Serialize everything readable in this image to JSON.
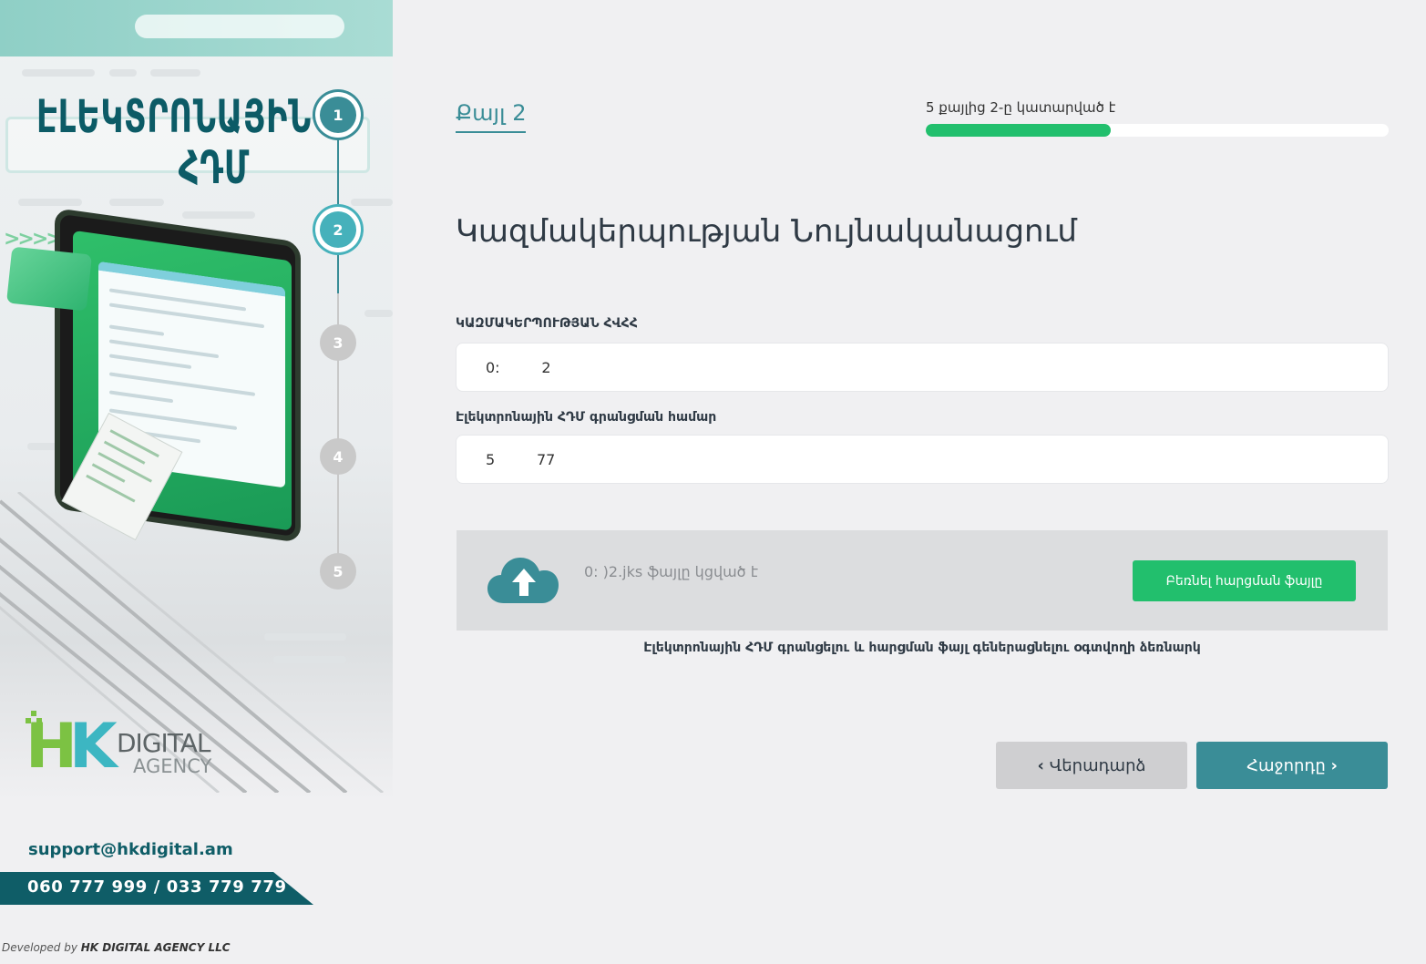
{
  "brand": {
    "title_line1": "ԷԼԵԿՏՐՈՆԱՅԻՆ",
    "title_line2": "ՀԴՄ",
    "logo_main": "HK",
    "logo_digital": "DIGITAL",
    "logo_agency": "AGENCY"
  },
  "stepper": {
    "steps": [
      "1",
      "2",
      "3",
      "4",
      "5"
    ],
    "current": 2
  },
  "contacts": {
    "email": "support@hkdigital.am",
    "phones": "060 777 999 / 033 779 779"
  },
  "footer": {
    "developed_by_prefix": "Developed by",
    "developer": "HK DIGITAL AGENCY LLC"
  },
  "header": {
    "step_title": "Քայլ 2",
    "progress_label": "5 քայլից 2-ը կատարված է",
    "progress_fraction": 0.4
  },
  "form": {
    "title": "Կազմակերպության Նույնականացում",
    "tin_label": "ԿԱԶՄԱԿԵՐՊՈՒԹՅԱՆ ՀՎՀՀ",
    "tin_value": "0:         2",
    "registration_label": "Էլեկտրոնային ՀԴՄ գրանցման համար",
    "registration_value": "5         77"
  },
  "upload": {
    "status": "0:         )2.jks ֆայլը կցված է",
    "download_button": "Բեռնել հարցման ֆայլը",
    "guide_link": "Էլեկտրոնային ՀԴՄ գրանցելու և հարցման ֆայլ գեներացնելու օգտվողի ձեռնարկ"
  },
  "navigation": {
    "back_label": "Վերադարձ",
    "next_label": "Հաջորդը"
  },
  "colors": {
    "teal": "#3a8d97",
    "green": "#22bf6d",
    "dark_teal": "#0f5d67"
  }
}
